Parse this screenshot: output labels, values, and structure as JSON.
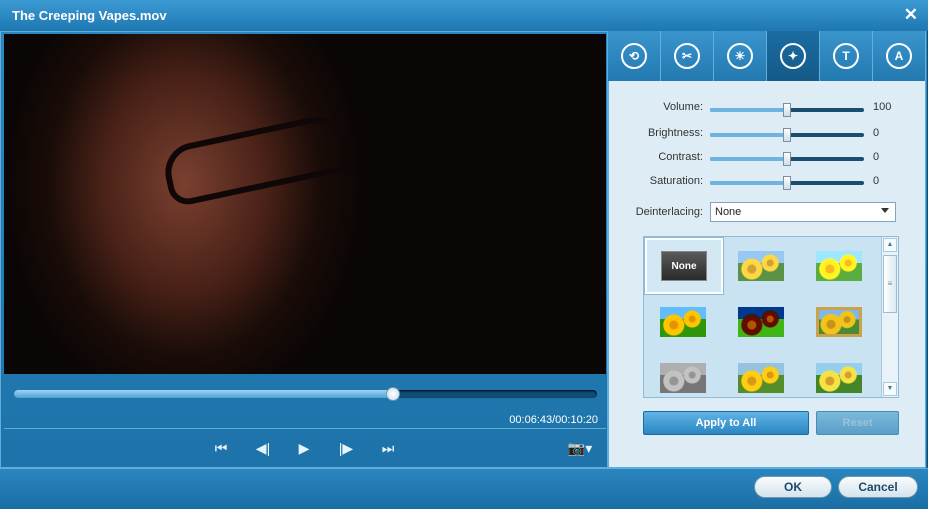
{
  "window": {
    "title": "The Creeping Vapes.mov",
    "close_glyph": "✕"
  },
  "player": {
    "time_display": "00:06:43/00:10:20",
    "progress_fraction": 0.65,
    "controls": {
      "prev": "⏮",
      "step_back": "◀|",
      "play": "▶",
      "step_fwd": "|▶",
      "next": "⏭",
      "snapshot": "📷▾"
    }
  },
  "tabs": [
    {
      "name": "tab-rotate",
      "icon": "rotate-icon",
      "glyph": "⟲"
    },
    {
      "name": "tab-trim",
      "icon": "scissors-icon",
      "glyph": "✂"
    },
    {
      "name": "tab-effect",
      "icon": "brightness-icon",
      "glyph": "☀"
    },
    {
      "name": "tab-enhance",
      "icon": "magic-wand-icon",
      "glyph": "✦",
      "active": true
    },
    {
      "name": "tab-watermark",
      "icon": "watermark-icon",
      "glyph": "T"
    },
    {
      "name": "tab-text",
      "icon": "text-icon",
      "glyph": "A"
    }
  ],
  "adjust": {
    "volume": {
      "label": "Volume:",
      "value": "100",
      "fraction": 0.5
    },
    "brightness": {
      "label": "Brightness:",
      "value": "0",
      "fraction": 0.5
    },
    "contrast": {
      "label": "Contrast:",
      "value": "0",
      "fraction": 0.5
    },
    "saturation": {
      "label": "Saturation:",
      "value": "0",
      "fraction": 0.5
    }
  },
  "deinterlacing": {
    "label": "Deinterlacing:",
    "selected": "None"
  },
  "filters": {
    "none_label": "None",
    "items": [
      "none",
      "warm",
      "bright",
      "vivid",
      "outline",
      "framed",
      "grayscale",
      "sunny",
      "sketch"
    ]
  },
  "buttons": {
    "apply_all": "Apply to All",
    "reset": "Reset",
    "ok": "OK",
    "cancel": "Cancel"
  }
}
